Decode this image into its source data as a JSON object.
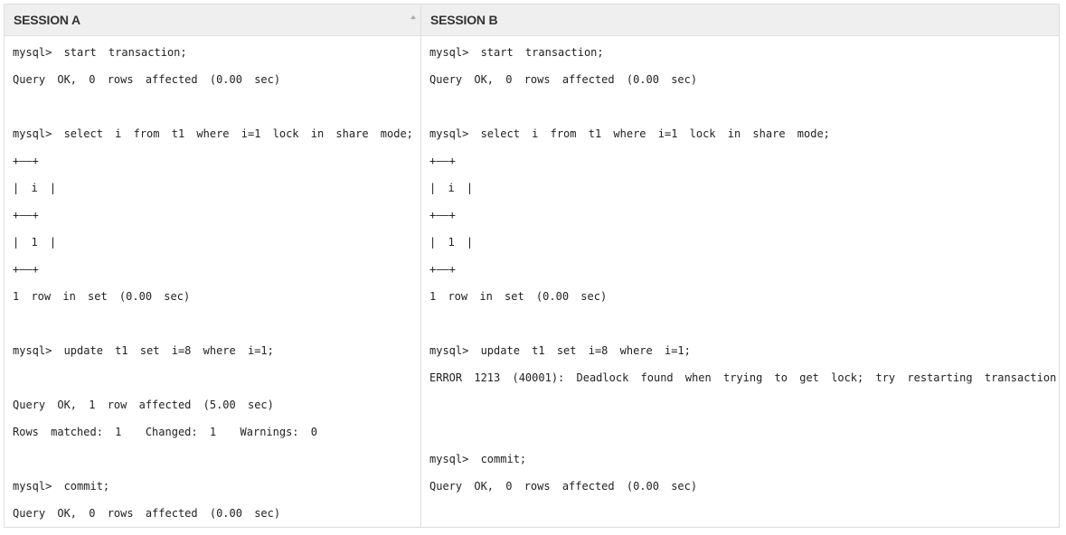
{
  "table": {
    "headers": [
      {
        "label": "SESSION A",
        "sort_icon": "sort-asc-icon"
      },
      {
        "label": "SESSION B"
      }
    ],
    "session_a": {
      "lines": [
        "mysql> start transaction;",
        "Query OK, 0 rows affected (0.00 sec)",
        "",
        "mysql> select i from t1 where i=1 lock in share mode;",
        "+——+",
        "| i |",
        "+——+",
        "| 1 |",
        "+——+",
        "1 row in set (0.00 sec)",
        "",
        "mysql> update t1 set i=8 where i=1;",
        "",
        "Query OK, 1 row affected (5.00 sec)",
        "Rows matched: 1  Changed: 1  Warnings: 0",
        "",
        "mysql> commit;",
        "Query OK, 0 rows affected (0.00 sec)"
      ]
    },
    "session_b": {
      "lines": [
        "mysql> start transaction;",
        "Query OK, 0 rows affected (0.00 sec)",
        "",
        "mysql> select i from t1 where i=1 lock in share mode;",
        "+——+",
        "| i |",
        "+——+",
        "| 1 |",
        "+——+",
        "1 row in set (0.00 sec)",
        "",
        "mysql> update t1 set i=8 where i=1;",
        "ERROR 1213 (40001): Deadlock found when trying to get lock; try restarting transaction",
        "",
        "",
        "mysql> commit;",
        "Query OK, 0 rows affected (0.00 sec)",
        ""
      ]
    }
  }
}
